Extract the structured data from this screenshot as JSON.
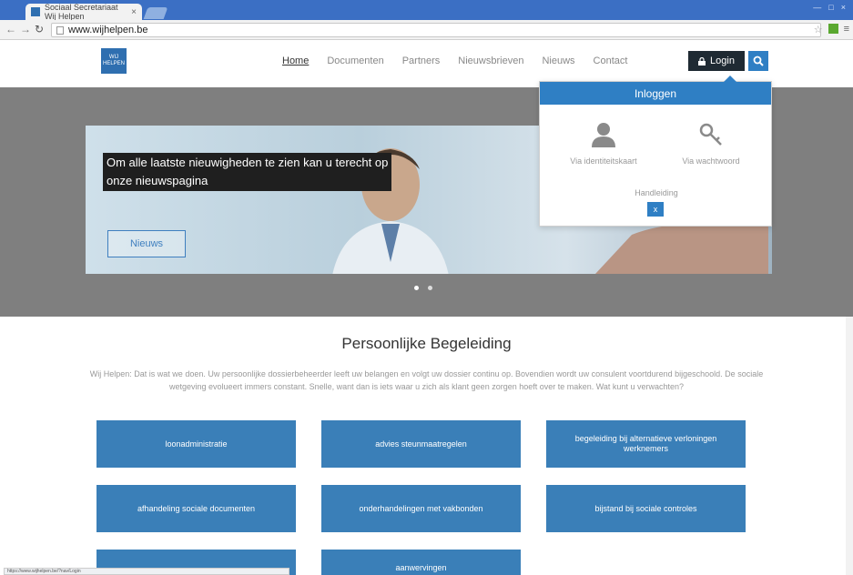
{
  "browser": {
    "tab_title": "Sociaal Secretariaat Wij Helpen",
    "tab_close": "×",
    "address": "www.wijhelpen.be",
    "window_buttons": [
      "—",
      "□",
      "×"
    ],
    "status_url": "https://www.wijhelpen.be/?nav/Login"
  },
  "header": {
    "logo_text": "WIJ HELPEN",
    "nav": [
      "Home",
      "Documenten",
      "Partners",
      "Nieuwsbrieven",
      "Nieuws",
      "Contact"
    ],
    "active_nav": "Home",
    "login_label": "Login"
  },
  "hero": {
    "caption_line1": "Om alle laatste nieuwigheden te zien kan u terecht op",
    "caption_line2": "onze nieuwspagina",
    "button_label": "Nieuws"
  },
  "login_panel": {
    "title": "Inloggen",
    "option_card": "Via identiteitskaart",
    "option_password": "Via wachtwoord",
    "manual": "Handleiding",
    "close": "x"
  },
  "content": {
    "title": "Persoonlijke Begeleiding",
    "intro": "Wij Helpen: Dat is wat we doen. Uw persoonlijke dossierbeheerder leeft uw belangen en volgt uw dossier continu op. Bovendien wordt uw consulent voortdurend bijgeschoold. De sociale wetgeving evolueert immers constant. Snelle, want dan is iets waar u zich als klant geen zorgen hoeft over te maken. Wat kunt u verwachten?",
    "services": [
      "loonadministratie",
      "advies steunmaatregelen",
      "begeleiding bij alternatieve verloningen werknemers",
      "afhandeling sociale documenten",
      "onderhandelingen met vakbonden",
      "bijstand bij sociale controles",
      "",
      "aanwervingen"
    ]
  },
  "colors": {
    "accent": "#2f7fc4",
    "tile": "#3a7fb8",
    "hero_bg": "#7f7f7f",
    "login_dark": "#1f2a33"
  }
}
